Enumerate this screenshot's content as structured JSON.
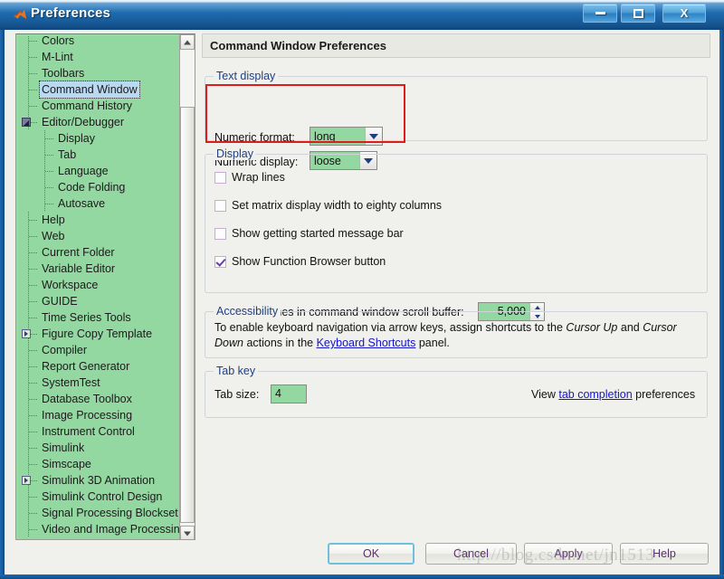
{
  "window": {
    "title": "Preferences",
    "icon": "matlab-logo-icon",
    "minimize_label": "Minimize",
    "maximize_label": "Maximize",
    "close_label": "X"
  },
  "sidebar": {
    "scrollbar": {
      "up_label": "Scroll up",
      "down_label": "Scroll down"
    },
    "items": [
      {
        "label": "Colors",
        "level": 1,
        "twisty": "none",
        "selected": false,
        "clipped": true
      },
      {
        "label": "M-Lint",
        "level": 1,
        "twisty": "none",
        "selected": false
      },
      {
        "label": "Toolbars",
        "level": 1,
        "twisty": "none",
        "selected": false
      },
      {
        "label": "Command Window",
        "level": 1,
        "twisty": "none",
        "selected": true
      },
      {
        "label": "Command History",
        "level": 1,
        "twisty": "none",
        "selected": false
      },
      {
        "label": "Editor/Debugger",
        "level": 1,
        "twisty": "open",
        "selected": false
      },
      {
        "label": "Display",
        "level": 2,
        "twisty": "none",
        "selected": false
      },
      {
        "label": "Tab",
        "level": 2,
        "twisty": "none",
        "selected": false
      },
      {
        "label": "Language",
        "level": 2,
        "twisty": "none",
        "selected": false
      },
      {
        "label": "Code Folding",
        "level": 2,
        "twisty": "none",
        "selected": false
      },
      {
        "label": "Autosave",
        "level": 2,
        "twisty": "none",
        "selected": false
      },
      {
        "label": "Help",
        "level": 1,
        "twisty": "none",
        "selected": false
      },
      {
        "label": "Web",
        "level": 1,
        "twisty": "none",
        "selected": false
      },
      {
        "label": "Current Folder",
        "level": 1,
        "twisty": "none",
        "selected": false
      },
      {
        "label": "Variable Editor",
        "level": 1,
        "twisty": "none",
        "selected": false
      },
      {
        "label": "Workspace",
        "level": 1,
        "twisty": "none",
        "selected": false
      },
      {
        "label": "GUIDE",
        "level": 1,
        "twisty": "none",
        "selected": false
      },
      {
        "label": "Time Series Tools",
        "level": 1,
        "twisty": "none",
        "selected": false
      },
      {
        "label": "Figure Copy Template",
        "level": 1,
        "twisty": "closed",
        "selected": false
      },
      {
        "label": "Compiler",
        "level": 1,
        "twisty": "none",
        "selected": false
      },
      {
        "label": "Report Generator",
        "level": 1,
        "twisty": "none",
        "selected": false
      },
      {
        "label": "SystemTest",
        "level": 1,
        "twisty": "none",
        "selected": false
      },
      {
        "label": "Database Toolbox",
        "level": 1,
        "twisty": "none",
        "selected": false
      },
      {
        "label": "Image Processing",
        "level": 1,
        "twisty": "none",
        "selected": false
      },
      {
        "label": "Instrument Control",
        "level": 1,
        "twisty": "none",
        "selected": false
      },
      {
        "label": "Simulink",
        "level": 1,
        "twisty": "none",
        "selected": false
      },
      {
        "label": "Simscape",
        "level": 1,
        "twisty": "none",
        "selected": false
      },
      {
        "label": "Simulink 3D Animation",
        "level": 1,
        "twisty": "closed",
        "selected": false
      },
      {
        "label": "Simulink Control Design",
        "level": 1,
        "twisty": "none",
        "selected": false
      },
      {
        "label": "Signal Processing Blockset",
        "level": 1,
        "twisty": "none",
        "selected": false
      },
      {
        "label": "Video and Image Processing",
        "level": 1,
        "twisty": "none",
        "selected": false
      }
    ]
  },
  "main": {
    "page_title": "Command Window Preferences",
    "text_display": {
      "group_title": "Text display",
      "numeric_format_label": "Numeric format:",
      "numeric_format_value": "long",
      "numeric_display_label": "Numeric display:",
      "numeric_display_value": "loose"
    },
    "display": {
      "group_title": "Display",
      "checkboxes": [
        {
          "label": "Wrap lines",
          "checked": false
        },
        {
          "label": "Set matrix display width to eighty columns",
          "checked": false
        },
        {
          "label": "Show getting started message bar",
          "checked": false
        },
        {
          "label": "Show Function Browser button",
          "checked": true
        }
      ],
      "scroll_buffer_label": "Number of lines in command window scroll buffer:",
      "scroll_buffer_value": "5,000"
    },
    "accessibility": {
      "group_title": "Accessibility",
      "text_part1": "To enable keyboard navigation via arrow keys, assign shortcuts to the ",
      "emph1": "Cursor Up",
      "text_part2": " and ",
      "emph2": "Cursor Down",
      "text_part3": " actions in the ",
      "link": "Keyboard Shortcuts",
      "text_part4": " panel."
    },
    "tab_key": {
      "group_title": "Tab key",
      "tab_size_label": "Tab size:",
      "tab_size_value": "4",
      "view_prefix": "View ",
      "view_link": "tab completion",
      "view_suffix": " preferences"
    }
  },
  "footer": {
    "ok": "OK",
    "cancel": "Cancel",
    "apply": "Apply",
    "help": "Help"
  },
  "watermark": "http://blog.csdn.net/jn1513",
  "colors": {
    "field_green": "#93d8a0",
    "title_blue": "#1f6cb0",
    "annotation_red": "#e01b1b",
    "link_blue": "#1414cc",
    "group_label_blue": "#1f3f80",
    "button_text_purple": "#5a2d6e",
    "selection_blue": "#b9d8f2"
  }
}
